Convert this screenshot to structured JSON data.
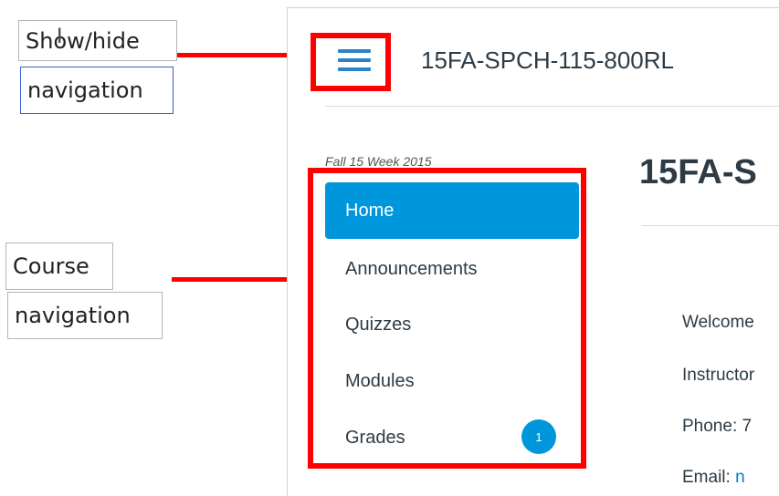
{
  "annotations": {
    "show_hide": "Show/hide",
    "navigation": "navigation",
    "course": "Course",
    "course_navigation": "navigation",
    "cursor_glyph": "I"
  },
  "header": {
    "menu_icon": "hamburger-icon",
    "course_title": "15FA-SPCH-115-800RL"
  },
  "sidebar": {
    "term": "Fall 15 Week 2015",
    "items": [
      {
        "label": "Home",
        "active": true
      },
      {
        "label": "Announcements"
      },
      {
        "label": "Quizzes"
      },
      {
        "label": "Modules"
      },
      {
        "label": "Grades",
        "badge": "1"
      }
    ]
  },
  "main": {
    "page_title": "15FA-S",
    "welcome": "Welcome",
    "instructor": "Instructor",
    "phone_label": "Phone:",
    "phone_value": "7",
    "email_label": "Email:",
    "email_value": "n"
  },
  "colors": {
    "accent": "#0096db",
    "annotation_red": "#ff0000",
    "text": "#2d3b45"
  }
}
